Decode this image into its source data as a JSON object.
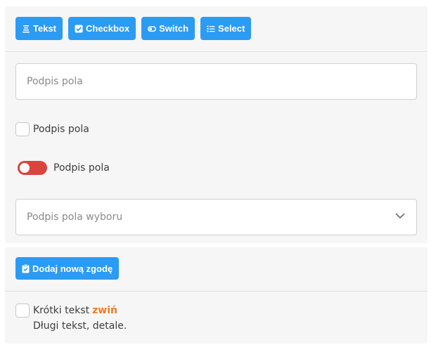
{
  "colors": {
    "primary": "#2b9bf4",
    "switch_off": "#d9443f",
    "link": "#f07b21",
    "panel_bg": "#f6f6f6"
  },
  "toolbar": {
    "buttons": [
      {
        "label": "Tekst",
        "icon": "text-align-icon"
      },
      {
        "label": "Checkbox",
        "icon": "checkbox-checked-icon"
      },
      {
        "label": "Switch",
        "icon": "toggle-icon"
      },
      {
        "label": "Select",
        "icon": "list-icon"
      }
    ]
  },
  "form": {
    "text_field": {
      "placeholder": "Podpis pola",
      "value": ""
    },
    "checkbox": {
      "label": "Podpis pola",
      "checked": false
    },
    "switch": {
      "label": "Podpis pola",
      "on": false
    },
    "select": {
      "placeholder": "Podpis pola wyboru",
      "icon": "chevron-down-icon"
    }
  },
  "consent_panel": {
    "add_button": {
      "label": "Dodaj nową zgodę",
      "icon": "clipboard-check-icon"
    },
    "consent": {
      "short_text": "Krótki tekst",
      "collapse_link": "zwiń",
      "long_text": "Długi tekst, detale.",
      "checked": false
    }
  }
}
